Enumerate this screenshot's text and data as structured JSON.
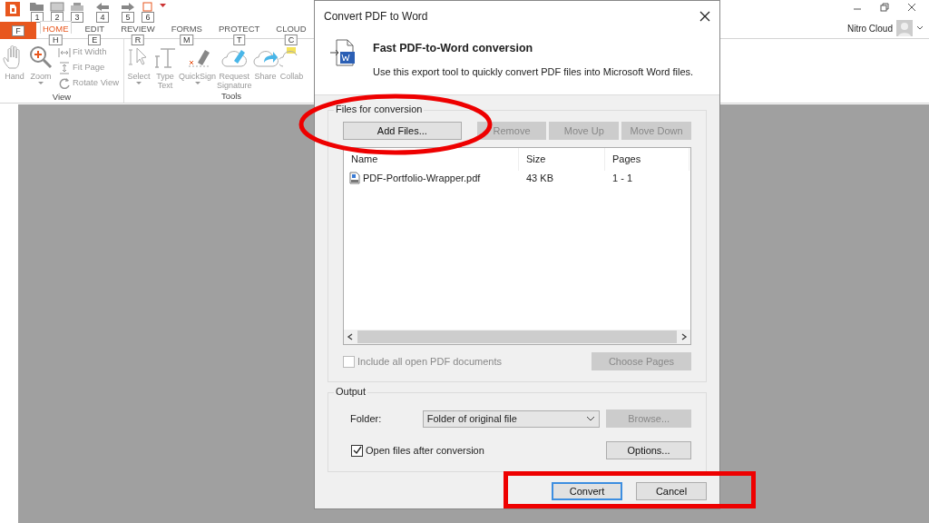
{
  "app": {
    "quick_access": [
      {
        "keytip": "1"
      },
      {
        "keytip": "2"
      },
      {
        "keytip": "3"
      },
      {
        "keytip": "4"
      },
      {
        "keytip": "5"
      },
      {
        "keytip": "6"
      }
    ],
    "file_tab": {
      "keytip": "F"
    },
    "tabs": [
      {
        "label": "HOME",
        "keytip": "H",
        "selected": true
      },
      {
        "label": "EDIT",
        "keytip": "E",
        "selected": false
      },
      {
        "label": "REVIEW",
        "keytip": "R",
        "selected": false
      },
      {
        "label": "FORMS",
        "keytip": "M",
        "selected": false
      },
      {
        "label": "PROTECT",
        "keytip": "T",
        "selected": false
      },
      {
        "label": "CLOUD",
        "keytip": "C",
        "selected": false
      }
    ],
    "ribbon_groups": [
      {
        "label": "View",
        "tools": [
          {
            "kind": "large",
            "label": "Hand",
            "dropdown": false
          },
          {
            "kind": "large",
            "label": "Zoom",
            "dropdown": true
          },
          {
            "kind": "stack",
            "items": [
              {
                "label": "Fit Width"
              },
              {
                "label": "Fit Page"
              },
              {
                "label": "Rotate View"
              }
            ]
          }
        ]
      },
      {
        "label": "Tools",
        "tools": [
          {
            "kind": "large",
            "label": "Select",
            "dropdown": true
          },
          {
            "kind": "large",
            "label": "Type Text",
            "dropdown": false
          },
          {
            "kind": "large",
            "label": "QuickSign",
            "dropdown": true
          },
          {
            "kind": "large",
            "label": "Request Signature",
            "dropdown": false
          },
          {
            "kind": "large",
            "label": "Share",
            "dropdown": false
          },
          {
            "kind": "large",
            "label": "Collab",
            "dropdown": false
          }
        ]
      }
    ],
    "account": {
      "label": "Nitro Cloud"
    }
  },
  "dialog": {
    "title": "Convert PDF to Word",
    "heading": "Fast PDF-to-Word conversion",
    "description": "Use this export tool to quickly convert PDF files into Microsoft Word files.",
    "files": {
      "title": "Files for conversion",
      "buttons": [
        {
          "label": "Add Files...",
          "disabled": false
        },
        {
          "label": "Remove",
          "disabled": true
        },
        {
          "label": "Move Up",
          "disabled": true
        },
        {
          "label": "Move Down",
          "disabled": true
        }
      ],
      "columns": [
        "Name",
        "Size",
        "Pages"
      ],
      "rows": [
        {
          "name": "PDF-Portfolio-Wrapper.pdf",
          "size": "43 KB",
          "pages": "1 - 1"
        }
      ],
      "include_all": {
        "label": "Include all open PDF documents",
        "checked": false,
        "disabled": true
      },
      "choose_pages": {
        "label": "Choose Pages",
        "disabled": true
      }
    },
    "output": {
      "title": "Output",
      "folder_label": "Folder:",
      "folder_value": "Folder of original file",
      "browse": {
        "label": "Browse...",
        "disabled": true
      },
      "open_after": {
        "label": "Open files after conversion",
        "checked": true,
        "disabled": false
      },
      "options": {
        "label": "Options...",
        "disabled": false
      }
    },
    "buttons": [
      {
        "label": "Convert",
        "default": true
      },
      {
        "label": "Cancel",
        "default": false
      }
    ]
  },
  "annotations": [
    {
      "kind": "ellipse"
    },
    {
      "kind": "rectangle"
    }
  ]
}
